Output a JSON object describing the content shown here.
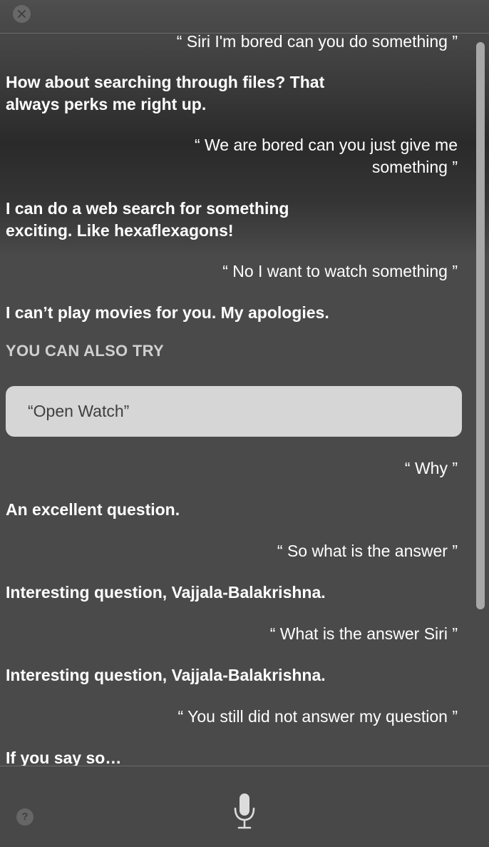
{
  "window": {
    "close_icon": "close-icon",
    "help_label": "?",
    "mic_icon": "microphone-icon"
  },
  "conversation": {
    "messages": [
      {
        "speaker": "user",
        "text": "“ Siri I'm bored can you do something ”"
      },
      {
        "speaker": "siri",
        "text": "How about searching through files? That always perks me right up."
      },
      {
        "speaker": "user",
        "text": "“ We are bored can you just give me something ”"
      },
      {
        "speaker": "siri",
        "text": "I can do a web search for something exciting. Like hexaflexagons!"
      },
      {
        "speaker": "user",
        "text": "“ No I want to watch something ”"
      },
      {
        "speaker": "siri",
        "text": "I can’t play movies for you. My apologies."
      },
      {
        "speaker": "user",
        "text": "“ Why ”"
      },
      {
        "speaker": "siri",
        "text": "An excellent question."
      },
      {
        "speaker": "user",
        "text": "“ So what is the answer ”"
      },
      {
        "speaker": "siri",
        "text": "Interesting question, Vajjala-Balakrishna."
      },
      {
        "speaker": "user",
        "text": "“ What is the answer Siri ”"
      },
      {
        "speaker": "siri",
        "text": "Interesting question, Vajjala-Balakrishna."
      },
      {
        "speaker": "user",
        "text": "“ You still did not answer my question ”"
      },
      {
        "speaker": "siri",
        "text": "If you say so…"
      }
    ],
    "suggestions": {
      "title": "YOU CAN ALSO TRY",
      "items": [
        "“Open Watch”"
      ]
    }
  },
  "colors": {
    "text": "#ffffff",
    "suggestion_bg": "#d6d6d6",
    "suggestion_text": "#3f3f3f",
    "divider": "#6c6c6c"
  }
}
